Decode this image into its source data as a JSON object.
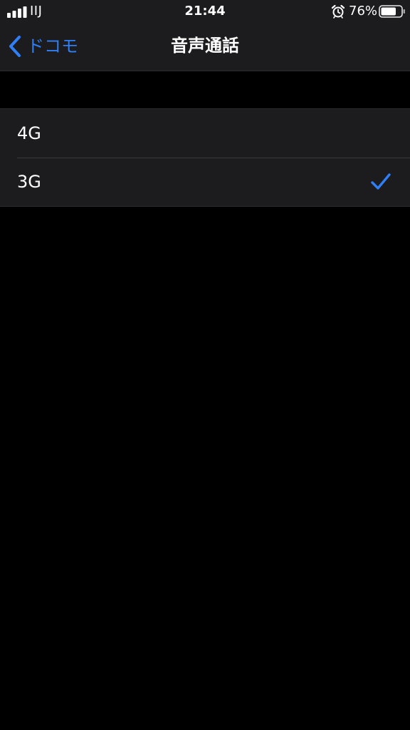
{
  "status_bar": {
    "carrier": "IIJ",
    "time": "21:44",
    "battery_percent": "76%",
    "battery_level": 0.76,
    "icons": [
      "signal-icon",
      "alarm-icon",
      "battery-icon"
    ]
  },
  "nav": {
    "back_label": "ドコモ",
    "title": "音声通話",
    "back_icon": "chevron-left-icon"
  },
  "options": [
    {
      "label": "4G",
      "selected": false
    },
    {
      "label": "3G",
      "selected": true
    }
  ],
  "colors": {
    "accent": "#2f7ff6",
    "background": "#000000",
    "panel": "#1c1c1e",
    "separator": "#38383a",
    "text": "#ffffff"
  }
}
